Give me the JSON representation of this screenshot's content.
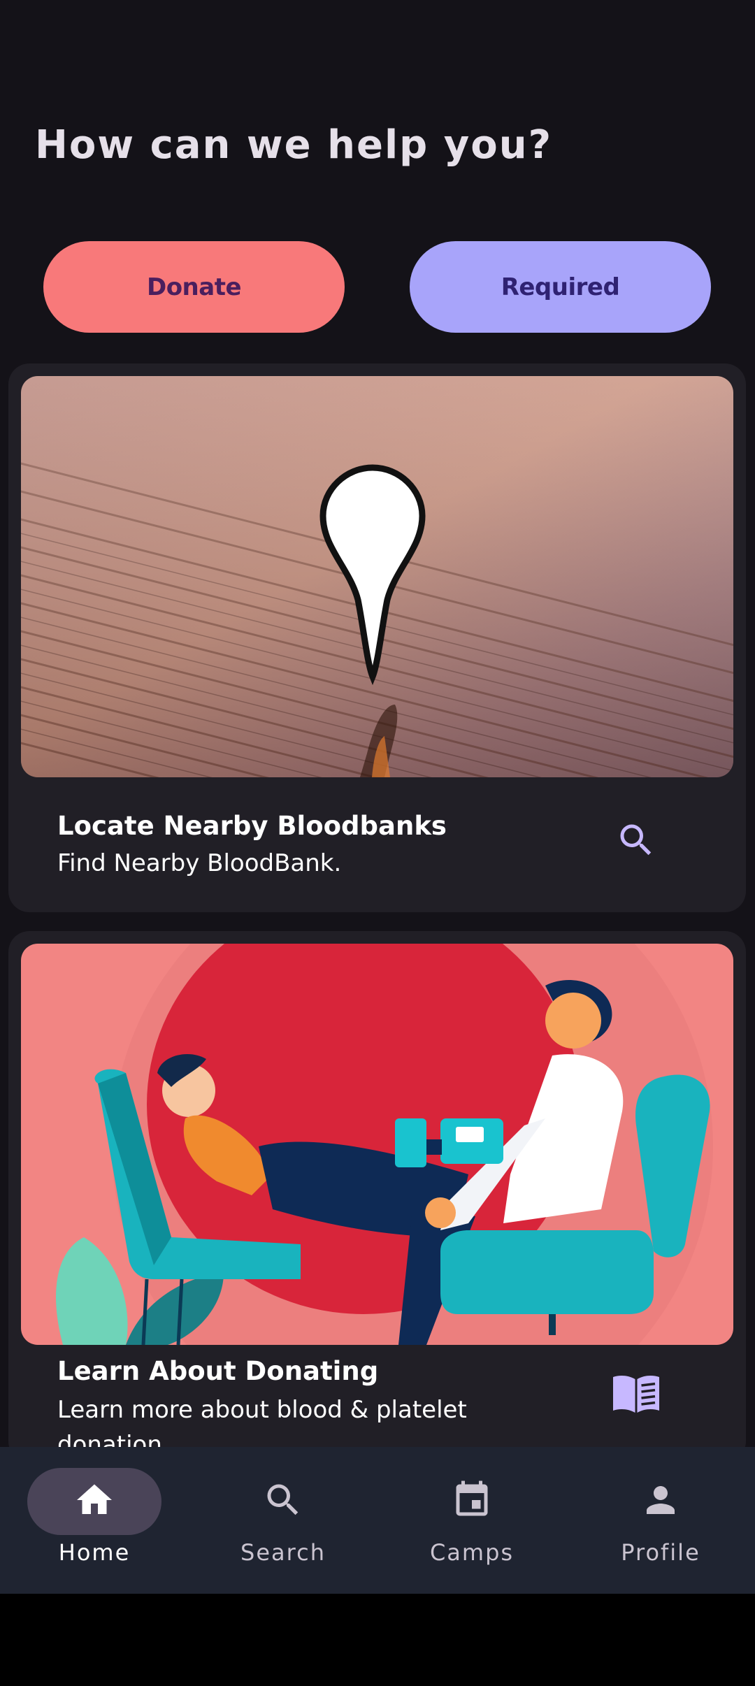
{
  "header": {
    "title": "How can we help you?"
  },
  "actions": {
    "donate_label": "Donate",
    "required_label": "Required"
  },
  "cards": [
    {
      "title": "Locate Nearby Bloodbanks",
      "subtitle": "Find Nearby BloodBank.",
      "icon": "search-icon"
    },
    {
      "title": "Learn About Donating",
      "subtitle": "Learn more about blood & platelet donation",
      "icon": "book-icon"
    }
  ],
  "nav": [
    {
      "label": "Home",
      "icon": "home-icon",
      "active": true
    },
    {
      "label": "Search",
      "icon": "search-icon",
      "active": false
    },
    {
      "label": "Camps",
      "icon": "calendar-icon",
      "active": false
    },
    {
      "label": "Profile",
      "icon": "person-icon",
      "active": false
    }
  ],
  "colors": {
    "background": "#141218",
    "donate": "#F8797A",
    "required": "#A8A4FA",
    "card": "#211F26",
    "nav": "#1F2431",
    "accent_icon": "#C7B8FF"
  }
}
